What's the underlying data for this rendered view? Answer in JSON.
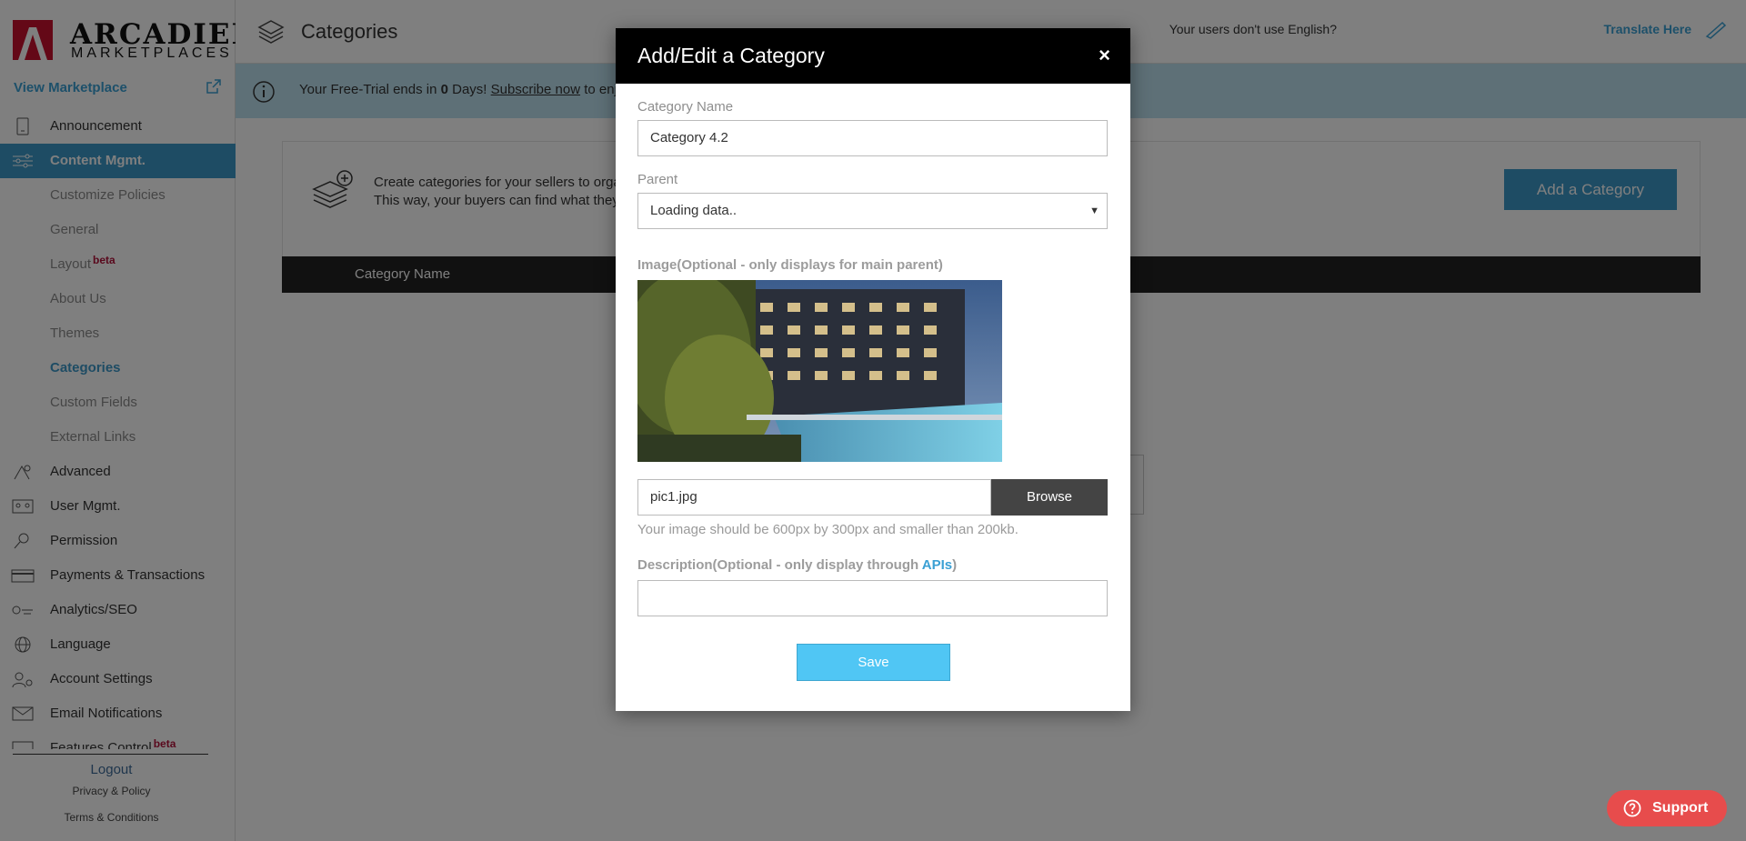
{
  "sidebar": {
    "logo_main": "ARCADIER",
    "logo_sub": "MARKETPLACES",
    "view_marketplace": "View Marketplace",
    "items": [
      {
        "label": "Announcement"
      },
      {
        "label": "Content Mgmt."
      },
      {
        "label": "Customize Policies"
      },
      {
        "label": "General"
      },
      {
        "label": "Layout",
        "badge": "beta"
      },
      {
        "label": "About Us"
      },
      {
        "label": "Themes"
      },
      {
        "label": "Categories"
      },
      {
        "label": "Custom Fields"
      },
      {
        "label": "External Links"
      },
      {
        "label": "Advanced"
      },
      {
        "label": "User Mgmt."
      },
      {
        "label": "Permission"
      },
      {
        "label": "Payments & Transactions"
      },
      {
        "label": "Analytics/SEO"
      },
      {
        "label": "Language"
      },
      {
        "label": "Account Settings"
      },
      {
        "label": "Email Notifications"
      },
      {
        "label": "Features Control",
        "badge": "beta"
      }
    ],
    "logout": "Logout",
    "privacy": "Privacy & Policy",
    "terms": "Terms & Conditions"
  },
  "header": {
    "title": "Categories",
    "english_prompt": "Your users don't use English?",
    "translate_link": "Translate Here"
  },
  "trial": {
    "prefix": "Your Free-Trial ends in ",
    "days": "0",
    "middle": " Days! ",
    "subscribe": "Subscribe now",
    "suffix": " to enjo"
  },
  "panel": {
    "line1": "Create categories for your sellers to orga",
    "line2": "This way, your buyers can find what they",
    "add_button": "Add a Category",
    "table_header": "Category Name"
  },
  "modal": {
    "title": "Add/Edit a Category",
    "close": "×",
    "category_name_label": "Category Name",
    "category_name_value": "Category 4.2",
    "parent_label": "Parent",
    "parent_value": "Loading data..",
    "image_label": "Image(Optional - only displays for main parent)",
    "file_name": "pic1.jpg",
    "browse": "Browse",
    "image_hint": "Your image should be 600px by 300px and smaller than 200kb.",
    "description_label_prefix": "Description(Optional - only display through ",
    "description_link": "APIs",
    "description_label_suffix": ")",
    "description_value": "",
    "save": "Save"
  },
  "support": {
    "label": "Support"
  },
  "colors": {
    "accent": "#3d98c9",
    "save": "#50c6f4",
    "support": "#e74c4c",
    "beta": "#b3123a"
  }
}
